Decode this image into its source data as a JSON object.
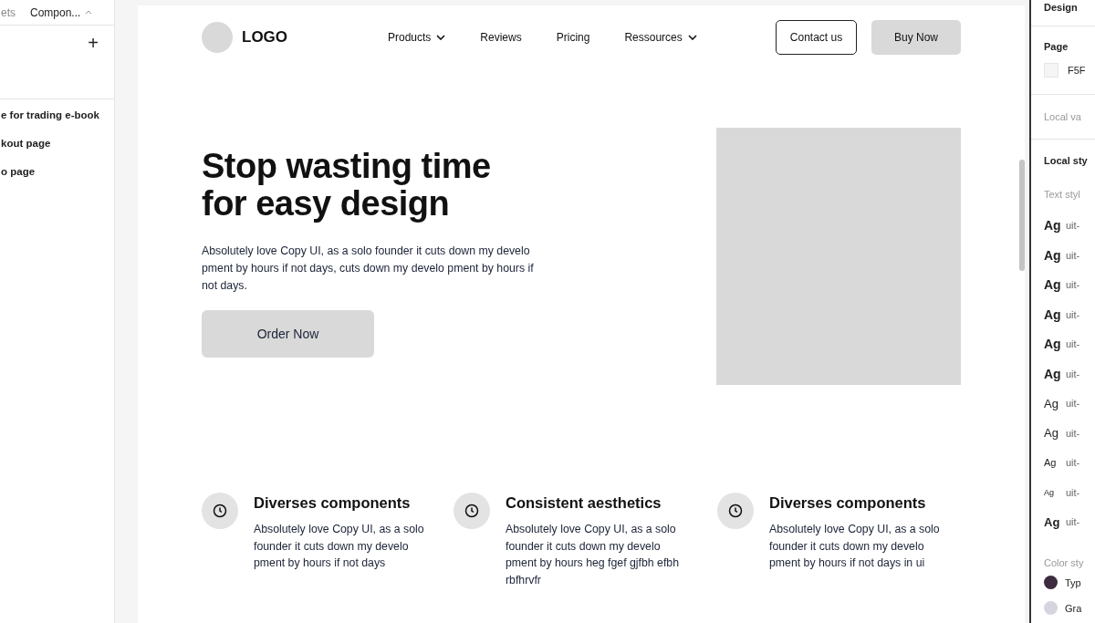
{
  "left_panel": {
    "tabs": [
      {
        "label": "ets",
        "selected": false
      },
      {
        "label": "Compon...",
        "selected": true
      }
    ],
    "add_symbol": "+",
    "pages": [
      "e for trading e-book",
      "kout page",
      "o page"
    ]
  },
  "frame": {
    "nav": {
      "logo": "LOGO",
      "links": [
        {
          "label": "Products",
          "dropdown": true
        },
        {
          "label": "Reviews",
          "dropdown": false
        },
        {
          "label": "Pricing",
          "dropdown": false
        },
        {
          "label": "Ressources",
          "dropdown": true
        }
      ],
      "secondary_button": "Contact us",
      "primary_button": "Buy Now"
    },
    "hero": {
      "title": "Stop wasting time for easy design",
      "text": "Absolutely love Copy UI, as a solo founder it cuts down my develo pment by hours if not days, cuts down my develo pment by hours if not days.",
      "button": "Order Now",
      "image": {
        "kind": "placeholder"
      }
    },
    "features": [
      {
        "title": "Diverses components",
        "text": "Absolutely love Copy UI, as a solo founder it cuts down my develo pment by hours if not days"
      },
      {
        "title": "Consistent aesthetics",
        "text": "Absolutely love Copy UI, as a solo founder it cuts down my develo pment by hours heg fgef gjfbh efbh rbfhrvfr"
      },
      {
        "title": "Diverses components",
        "text": "Absolutely love Copy UI, as a solo founder it cuts down my develo pment by hours if not days in ui"
      }
    ]
  },
  "right_panel": {
    "tab": "Design",
    "page_heading": "Page",
    "page_color": "F5F",
    "local_variables": "Local va",
    "local_styles": "Local sty",
    "text_styles_heading": "Text styl",
    "text_styles": [
      {
        "sample": "Ag",
        "name": "uit-"
      },
      {
        "sample": "Ag",
        "name": "uit-"
      },
      {
        "sample": "Ag",
        "name": "uit-"
      },
      {
        "sample": "Ag",
        "name": "uit-"
      },
      {
        "sample": "Ag",
        "name": "uit-"
      },
      {
        "sample": "Ag",
        "name": "uit-"
      },
      {
        "sample": "Ag",
        "name": "uit-"
      },
      {
        "sample": "Ag",
        "name": "uit-"
      },
      {
        "sample": "Ag",
        "name": "uit-"
      },
      {
        "sample": "Ag",
        "name": "uit-"
      },
      {
        "sample": "Ag",
        "name": "uit-"
      }
    ],
    "color_styles_heading": "Color sty",
    "color_styles": [
      {
        "name": "Typ",
        "color": "#3d2b3f"
      },
      {
        "name": "Gra",
        "color": "#d6d4de"
      }
    ]
  }
}
